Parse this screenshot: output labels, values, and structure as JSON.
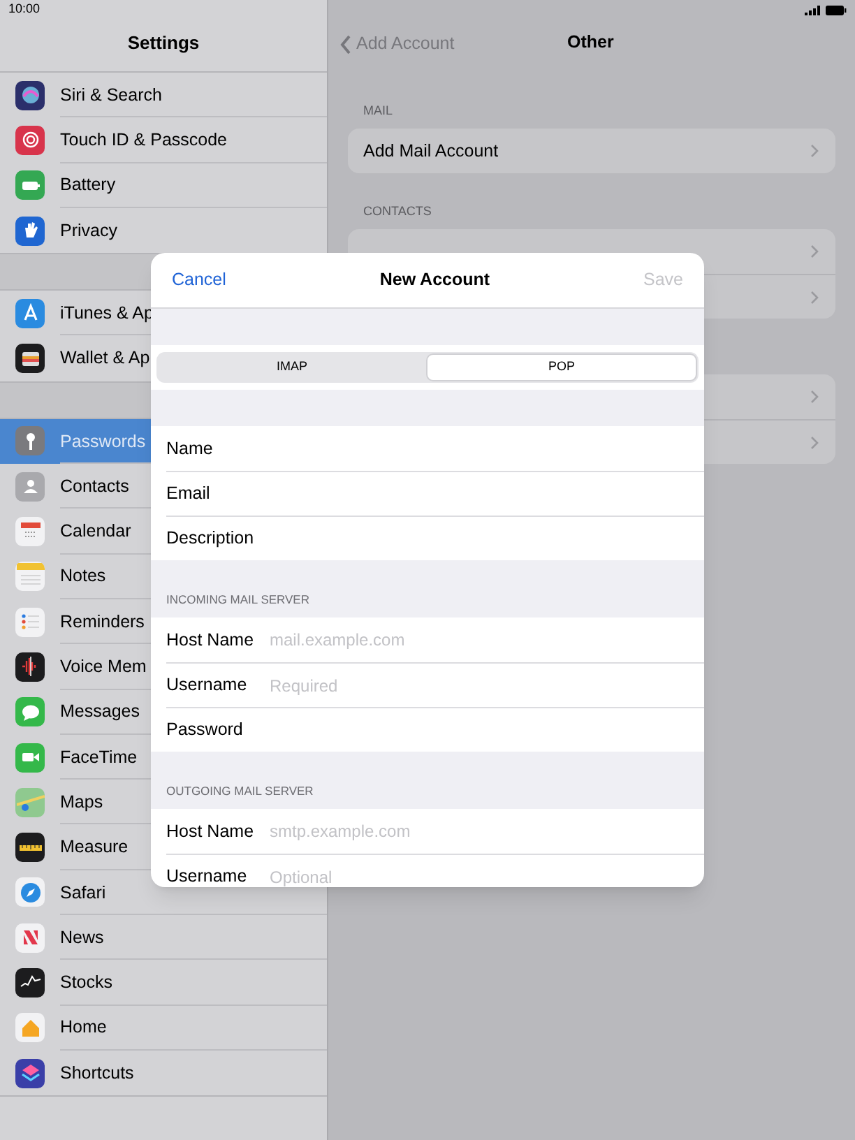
{
  "status_bar": {
    "time": "10:00"
  },
  "sidebar": {
    "title": "Settings",
    "groups": [
      {
        "items": [
          {
            "label": "Siri & Search",
            "color": "#2b2f6b",
            "selected": false
          },
          {
            "label": "Touch ID & Passcode",
            "color": "#d8344c",
            "selected": false
          },
          {
            "label": "Battery",
            "color": "#34a853",
            "selected": false
          },
          {
            "label": "Privacy",
            "color": "#1f66d1",
            "selected": false
          }
        ]
      },
      {
        "items": [
          {
            "label": "iTunes & Ap",
            "color": "#2a8be0",
            "selected": false
          },
          {
            "label": "Wallet & Ap",
            "color": "#1c1c1e",
            "selected": false
          }
        ]
      },
      {
        "items": [
          {
            "label": "Passwords",
            "color": "#7a7a7e",
            "selected": true
          },
          {
            "label": "Contacts",
            "color": "#a9a9ad",
            "selected": false
          },
          {
            "label": "Calendar",
            "color": "#f2f2f4",
            "selected": false
          },
          {
            "label": "Notes",
            "color": "#f2f2f4",
            "selected": false
          },
          {
            "label": "Reminders",
            "color": "#f2f2f4",
            "selected": false
          },
          {
            "label": "Voice Mem",
            "color": "#1c1c1e",
            "selected": false
          },
          {
            "label": "Messages",
            "color": "#34b84a",
            "selected": false
          },
          {
            "label": "FaceTime",
            "color": "#34b84a",
            "selected": false
          },
          {
            "label": "Maps",
            "color": "#8fc98f",
            "selected": false
          },
          {
            "label": "Measure",
            "color": "#1c1c1e",
            "selected": false
          },
          {
            "label": "Safari",
            "color": "#f2f2f4",
            "selected": false
          },
          {
            "label": "News",
            "color": "#f2f2f4",
            "selected": false
          },
          {
            "label": "Stocks",
            "color": "#1c1c1e",
            "selected": false
          },
          {
            "label": "Home",
            "color": "#f2f2f4",
            "selected": false
          },
          {
            "label": "Shortcuts",
            "color": "#3a3fa8",
            "selected": false
          }
        ]
      }
    ]
  },
  "detail": {
    "back": "Add Account",
    "title": "Other",
    "sections": [
      {
        "header": "MAIL",
        "rows": [
          {
            "label": "Add Mail Account"
          }
        ]
      },
      {
        "header": "CONTACTS",
        "rows": [
          {},
          {}
        ]
      },
      {
        "rows": [
          {},
          {}
        ]
      }
    ]
  },
  "dialog": {
    "cancel": "Cancel",
    "title": "New Account",
    "save": "Save",
    "save_disabled": true,
    "segments": [
      {
        "label": "IMAP",
        "selected": false
      },
      {
        "label": "POP",
        "selected": true
      }
    ],
    "sections": [
      {
        "fields": [
          {
            "label": "Name"
          },
          {
            "label": "Email"
          },
          {
            "label": "Description"
          }
        ]
      },
      {
        "header": "INCOMING MAIL SERVER",
        "fields": [
          {
            "label": "Host Name",
            "placeholder": "mail.example.com"
          },
          {
            "label": "Username",
            "placeholder": "Required"
          },
          {
            "label": "Password"
          }
        ]
      },
      {
        "header": "OUTGOING MAIL SERVER",
        "fields": [
          {
            "label": "Host Name",
            "placeholder": "smtp.example.com"
          },
          {
            "label": "Username",
            "placeholder": "Optional"
          }
        ]
      }
    ]
  }
}
